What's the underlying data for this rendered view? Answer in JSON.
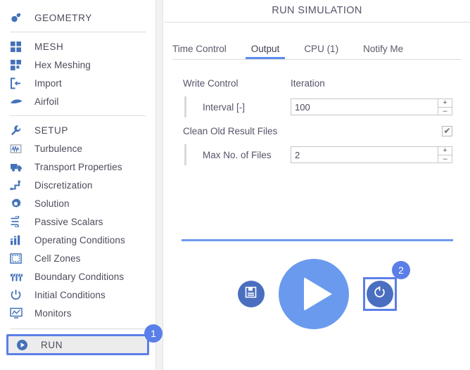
{
  "sidebar": {
    "groups": [
      {
        "items": [
          {
            "label": "GEOMETRY",
            "icon": "geometry-icon",
            "head": true
          }
        ]
      },
      {
        "items": [
          {
            "label": "MESH",
            "icon": "mesh-icon",
            "head": true
          },
          {
            "label": "Hex Meshing",
            "icon": "hex-meshing-icon",
            "head": false
          },
          {
            "label": "Import",
            "icon": "import-icon",
            "head": false
          },
          {
            "label": "Airfoil",
            "icon": "airfoil-icon",
            "head": false
          }
        ]
      },
      {
        "items": [
          {
            "label": "SETUP",
            "icon": "wrench-icon",
            "head": true
          },
          {
            "label": "Turbulence",
            "icon": "turbulence-icon",
            "head": false
          },
          {
            "label": "Transport Properties",
            "icon": "transport-properties-icon",
            "head": false
          },
          {
            "label": "Discretization",
            "icon": "discretization-icon",
            "head": false
          },
          {
            "label": "Solution",
            "icon": "gear-icon",
            "head": false
          },
          {
            "label": "Passive Scalars",
            "icon": "passive-scalars-icon",
            "head": false
          },
          {
            "label": "Operating Conditions",
            "icon": "operating-conditions-icon",
            "head": false
          },
          {
            "label": "Cell Zones",
            "icon": "cell-zones-icon",
            "head": false
          },
          {
            "label": "Boundary Conditions",
            "icon": "boundary-conditions-icon",
            "head": false
          },
          {
            "label": "Initial Conditions",
            "icon": "initial-conditions-icon",
            "head": false
          },
          {
            "label": "Monitors",
            "icon": "monitors-icon",
            "head": false
          }
        ]
      }
    ],
    "run_item": {
      "label": "RUN",
      "icon": "run-play-icon"
    }
  },
  "annotations": {
    "badge_one": "1",
    "badge_two": "2"
  },
  "main": {
    "title": "RUN SIMULATION",
    "tabs": [
      {
        "label": "Time Control",
        "active": false
      },
      {
        "label": "Output",
        "active": true
      },
      {
        "label": "CPU  (1)",
        "active": false
      },
      {
        "label": "Notify Me",
        "active": false
      }
    ],
    "form": {
      "write_control": {
        "label": "Write Control",
        "value": "Iteration"
      },
      "interval": {
        "label": "Interval [-]",
        "value": "100",
        "placeholder": "",
        "increment": "+",
        "decrement": "–"
      },
      "clean_old_result_files": {
        "label": "Clean Old Result Files",
        "checked": true,
        "check_glyph": "✔"
      },
      "max_no_of_files": {
        "label": "Max No. of Files",
        "value": "2",
        "placeholder": "",
        "increment": "+",
        "decrement": "–"
      }
    },
    "actions": {
      "save": {
        "name": "save-simulation-button",
        "icon": "floppy-disk-icon"
      },
      "run": {
        "name": "run-simulation-button",
        "icon": "play-icon"
      },
      "reset": {
        "name": "reset-simulation-button",
        "icon": "reset-icon"
      }
    }
  },
  "colors": {
    "accent_blue": "#5b7fe8",
    "play_blue": "#6a9aee",
    "icon_blue": "#4472b8",
    "dark_button_blue": "#4a6fc0",
    "text": "#4c4c5c",
    "rule": "#dcdcdc"
  }
}
